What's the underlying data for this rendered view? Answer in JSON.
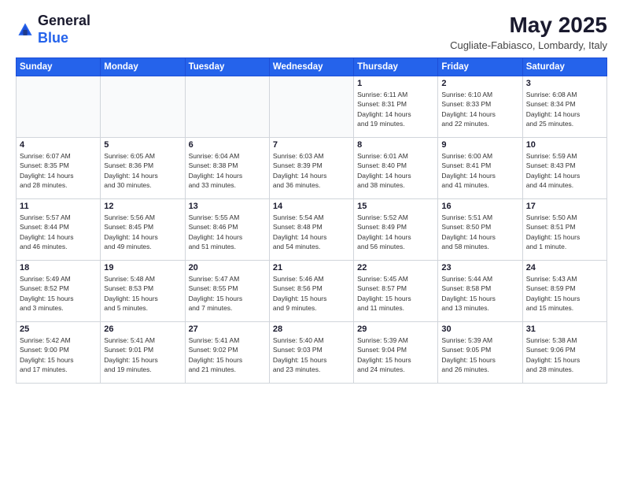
{
  "header": {
    "logo": {
      "general": "General",
      "blue": "Blue"
    },
    "title": "May 2025",
    "location": "Cugliate-Fabiasco, Lombardy, Italy"
  },
  "weekdays": [
    "Sunday",
    "Monday",
    "Tuesday",
    "Wednesday",
    "Thursday",
    "Friday",
    "Saturday"
  ],
  "weeks": [
    [
      {
        "day": "",
        "info": ""
      },
      {
        "day": "",
        "info": ""
      },
      {
        "day": "",
        "info": ""
      },
      {
        "day": "",
        "info": ""
      },
      {
        "day": "1",
        "info": "Sunrise: 6:11 AM\nSunset: 8:31 PM\nDaylight: 14 hours\nand 19 minutes."
      },
      {
        "day": "2",
        "info": "Sunrise: 6:10 AM\nSunset: 8:33 PM\nDaylight: 14 hours\nand 22 minutes."
      },
      {
        "day": "3",
        "info": "Sunrise: 6:08 AM\nSunset: 8:34 PM\nDaylight: 14 hours\nand 25 minutes."
      }
    ],
    [
      {
        "day": "4",
        "info": "Sunrise: 6:07 AM\nSunset: 8:35 PM\nDaylight: 14 hours\nand 28 minutes."
      },
      {
        "day": "5",
        "info": "Sunrise: 6:05 AM\nSunset: 8:36 PM\nDaylight: 14 hours\nand 30 minutes."
      },
      {
        "day": "6",
        "info": "Sunrise: 6:04 AM\nSunset: 8:38 PM\nDaylight: 14 hours\nand 33 minutes."
      },
      {
        "day": "7",
        "info": "Sunrise: 6:03 AM\nSunset: 8:39 PM\nDaylight: 14 hours\nand 36 minutes."
      },
      {
        "day": "8",
        "info": "Sunrise: 6:01 AM\nSunset: 8:40 PM\nDaylight: 14 hours\nand 38 minutes."
      },
      {
        "day": "9",
        "info": "Sunrise: 6:00 AM\nSunset: 8:41 PM\nDaylight: 14 hours\nand 41 minutes."
      },
      {
        "day": "10",
        "info": "Sunrise: 5:59 AM\nSunset: 8:43 PM\nDaylight: 14 hours\nand 44 minutes."
      }
    ],
    [
      {
        "day": "11",
        "info": "Sunrise: 5:57 AM\nSunset: 8:44 PM\nDaylight: 14 hours\nand 46 minutes."
      },
      {
        "day": "12",
        "info": "Sunrise: 5:56 AM\nSunset: 8:45 PM\nDaylight: 14 hours\nand 49 minutes."
      },
      {
        "day": "13",
        "info": "Sunrise: 5:55 AM\nSunset: 8:46 PM\nDaylight: 14 hours\nand 51 minutes."
      },
      {
        "day": "14",
        "info": "Sunrise: 5:54 AM\nSunset: 8:48 PM\nDaylight: 14 hours\nand 54 minutes."
      },
      {
        "day": "15",
        "info": "Sunrise: 5:52 AM\nSunset: 8:49 PM\nDaylight: 14 hours\nand 56 minutes."
      },
      {
        "day": "16",
        "info": "Sunrise: 5:51 AM\nSunset: 8:50 PM\nDaylight: 14 hours\nand 58 minutes."
      },
      {
        "day": "17",
        "info": "Sunrise: 5:50 AM\nSunset: 8:51 PM\nDaylight: 15 hours\nand 1 minute."
      }
    ],
    [
      {
        "day": "18",
        "info": "Sunrise: 5:49 AM\nSunset: 8:52 PM\nDaylight: 15 hours\nand 3 minutes."
      },
      {
        "day": "19",
        "info": "Sunrise: 5:48 AM\nSunset: 8:53 PM\nDaylight: 15 hours\nand 5 minutes."
      },
      {
        "day": "20",
        "info": "Sunrise: 5:47 AM\nSunset: 8:55 PM\nDaylight: 15 hours\nand 7 minutes."
      },
      {
        "day": "21",
        "info": "Sunrise: 5:46 AM\nSunset: 8:56 PM\nDaylight: 15 hours\nand 9 minutes."
      },
      {
        "day": "22",
        "info": "Sunrise: 5:45 AM\nSunset: 8:57 PM\nDaylight: 15 hours\nand 11 minutes."
      },
      {
        "day": "23",
        "info": "Sunrise: 5:44 AM\nSunset: 8:58 PM\nDaylight: 15 hours\nand 13 minutes."
      },
      {
        "day": "24",
        "info": "Sunrise: 5:43 AM\nSunset: 8:59 PM\nDaylight: 15 hours\nand 15 minutes."
      }
    ],
    [
      {
        "day": "25",
        "info": "Sunrise: 5:42 AM\nSunset: 9:00 PM\nDaylight: 15 hours\nand 17 minutes."
      },
      {
        "day": "26",
        "info": "Sunrise: 5:41 AM\nSunset: 9:01 PM\nDaylight: 15 hours\nand 19 minutes."
      },
      {
        "day": "27",
        "info": "Sunrise: 5:41 AM\nSunset: 9:02 PM\nDaylight: 15 hours\nand 21 minutes."
      },
      {
        "day": "28",
        "info": "Sunrise: 5:40 AM\nSunset: 9:03 PM\nDaylight: 15 hours\nand 23 minutes."
      },
      {
        "day": "29",
        "info": "Sunrise: 5:39 AM\nSunset: 9:04 PM\nDaylight: 15 hours\nand 24 minutes."
      },
      {
        "day": "30",
        "info": "Sunrise: 5:39 AM\nSunset: 9:05 PM\nDaylight: 15 hours\nand 26 minutes."
      },
      {
        "day": "31",
        "info": "Sunrise: 5:38 AM\nSunset: 9:06 PM\nDaylight: 15 hours\nand 28 minutes."
      }
    ]
  ]
}
